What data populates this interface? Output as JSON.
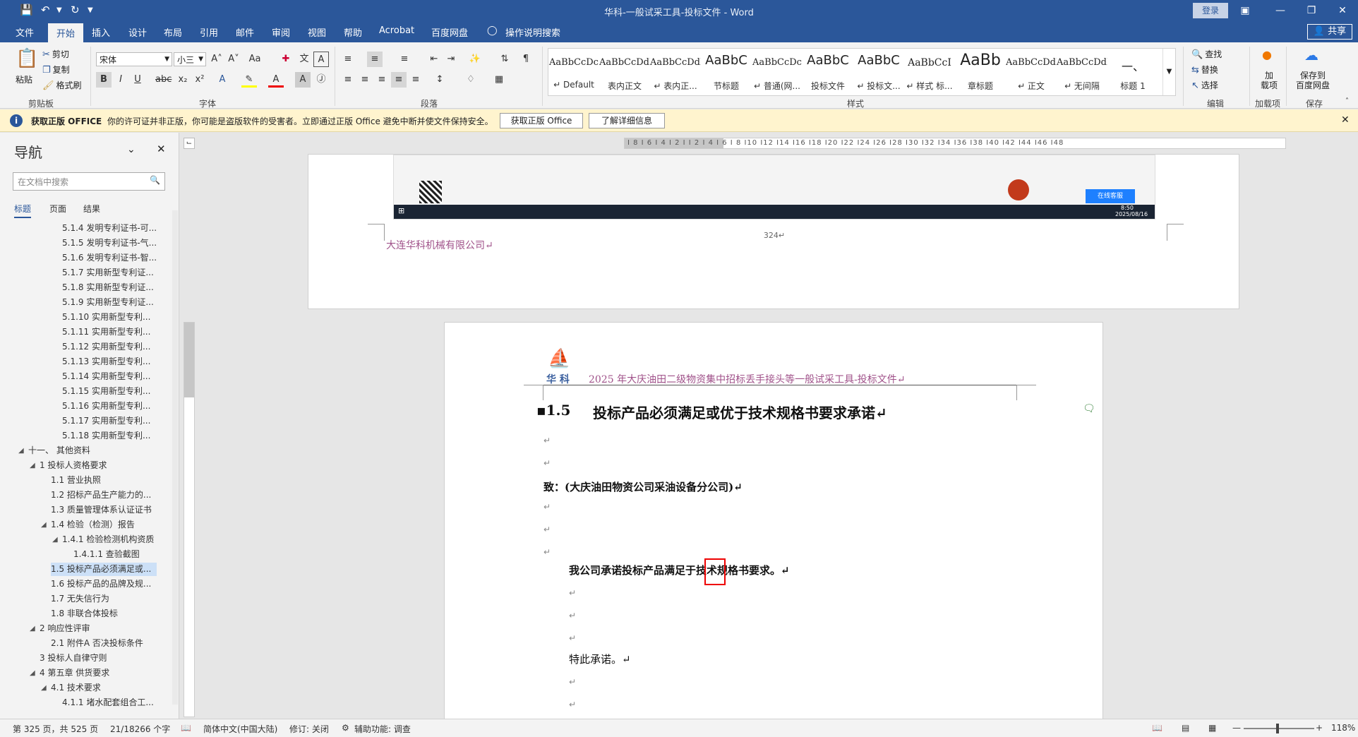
{
  "titlebar": {
    "title": "华科-一般试采工具-投标文件  -  Word",
    "login": "登录",
    "undo_icon": "undo-icon",
    "redo_icon": "redo-icon"
  },
  "menu": {
    "tabs": [
      "文件",
      "开始",
      "插入",
      "设计",
      "布局",
      "引用",
      "邮件",
      "审阅",
      "视图",
      "帮助",
      "Acrobat",
      "百度网盘"
    ],
    "tell_me": "操作说明搜索",
    "share": "共享"
  },
  "ribbon": {
    "clipboard": {
      "paste": "粘贴",
      "cut": "剪切",
      "copy": "复制",
      "format_painter": "格式刷",
      "label": "剪贴板"
    },
    "font": {
      "name": "宋体",
      "size": "小三",
      "label": "字体"
    },
    "paragraph": {
      "label": "段落"
    },
    "styles": {
      "label": "样式",
      "items": [
        {
          "sample": "AaBbCcDc",
          "name": "↵ Default"
        },
        {
          "sample": "AaBbCcDdI",
          "name": "表内正文"
        },
        {
          "sample": "AaBbCcDdI",
          "name": "↵ 表内正..."
        },
        {
          "sample": "AaBbC",
          "name": "节标题"
        },
        {
          "sample": "AaBbCcDc",
          "name": "↵ 普通(网..."
        },
        {
          "sample": "AaBbC",
          "name": "投标文件"
        },
        {
          "sample": "AaBbC",
          "name": "↵ 投标文..."
        },
        {
          "sample": "AaBbCcI",
          "name": "↵ 样式 标..."
        },
        {
          "sample": "AaBb",
          "name": "章标题"
        },
        {
          "sample": "AaBbCcDdI",
          "name": "↵ 正文"
        },
        {
          "sample": "AaBbCcDdI",
          "name": "↵ 无间隔"
        },
        {
          "sample": "一、",
          "name": "标题 1"
        }
      ]
    },
    "editing": {
      "find": "查找",
      "replace": "替换",
      "select": "选择",
      "label": "编辑"
    },
    "addins": {
      "load": "加\n载项",
      "label": "加载项"
    },
    "save": {
      "baidu": "保存到\n百度网盘",
      "label": "保存"
    }
  },
  "infobar": {
    "title": "获取正版 OFFICE",
    "message": "你的许可证并非正版，你可能是盗版软件的受害者。立即通过正版 Office 避免中断并使文件保持安全。",
    "btn_get": "获取正版 Office",
    "btn_learn": "了解详细信息"
  },
  "nav": {
    "title": "导航",
    "search_placeholder": "在文档中搜索",
    "tabs": [
      "标题",
      "页面",
      "结果"
    ],
    "items": [
      {
        "text": "5.1.4 发明专利证书-可...",
        "level": 4,
        "tri": ""
      },
      {
        "text": "5.1.5 发明专利证书-气...",
        "level": 4,
        "tri": ""
      },
      {
        "text": "5.1.6 发明专利证书-智...",
        "level": 4,
        "tri": ""
      },
      {
        "text": "5.1.7 实用新型专利证...",
        "level": 4,
        "tri": ""
      },
      {
        "text": "5.1.8 实用新型专利证...",
        "level": 4,
        "tri": ""
      },
      {
        "text": "5.1.9 实用新型专利证...",
        "level": 4,
        "tri": ""
      },
      {
        "text": "5.1.10 实用新型专利...",
        "level": 4,
        "tri": ""
      },
      {
        "text": "5.1.11 实用新型专利...",
        "level": 4,
        "tri": ""
      },
      {
        "text": "5.1.12 实用新型专利...",
        "level": 4,
        "tri": ""
      },
      {
        "text": "5.1.13 实用新型专利...",
        "level": 4,
        "tri": ""
      },
      {
        "text": "5.1.14 实用新型专利...",
        "level": 4,
        "tri": ""
      },
      {
        "text": "5.1.15 实用新型专利...",
        "level": 4,
        "tri": ""
      },
      {
        "text": "5.1.16 实用新型专利...",
        "level": 4,
        "tri": ""
      },
      {
        "text": "5.1.17 实用新型专利...",
        "level": 4,
        "tri": ""
      },
      {
        "text": "5.1.18 实用新型专利...",
        "level": 4,
        "tri": ""
      },
      {
        "text": "十一、 其他资料",
        "level": 1,
        "tri": "◢"
      },
      {
        "text": "1 投标人资格要求",
        "level": 2,
        "tri": "◢"
      },
      {
        "text": "1.1 营业执照",
        "level": 3,
        "tri": ""
      },
      {
        "text": "1.2 招标产品生产能力的...",
        "level": 3,
        "tri": ""
      },
      {
        "text": "1.3 质量管理体系认证证书",
        "level": 3,
        "tri": ""
      },
      {
        "text": "1.4 检验（检测）报告",
        "level": 3,
        "tri": "◢"
      },
      {
        "text": "1.4.1 检验检测机构资质",
        "level": 4,
        "tri": "◢"
      },
      {
        "text": "1.4.1.1 查验截图",
        "level": 5,
        "tri": ""
      },
      {
        "text": "1.5 投标产品必须满足或...",
        "level": 3,
        "tri": "",
        "selected": true
      },
      {
        "text": "1.6 投标产品的品牌及规...",
        "level": 3,
        "tri": ""
      },
      {
        "text": "1.7 无失信行为",
        "level": 3,
        "tri": ""
      },
      {
        "text": "1.8 非联合体投标",
        "level": 3,
        "tri": ""
      },
      {
        "text": "2 响应性评审",
        "level": 2,
        "tri": "◢"
      },
      {
        "text": "2.1 附件A 否决投标条件",
        "level": 3,
        "tri": ""
      },
      {
        "text": "3 投标人自律守则",
        "level": 2,
        "tri": ""
      },
      {
        "text": "4 第五章  供货要求",
        "level": 2,
        "tri": "◢"
      },
      {
        "text": "4.1 技术要求",
        "level": 3,
        "tri": "◢"
      },
      {
        "text": "4.1.1 堵水配套组合工...",
        "level": 4,
        "tri": ""
      }
    ]
  },
  "document": {
    "page1": {
      "page_number": "324↵",
      "company_footer": "大连华科机械有限公司↵",
      "taskbar_time": "8:50",
      "taskbar_date": "2025/08/16",
      "online_service": "在线客服"
    },
    "page2": {
      "logo_text": "华 科",
      "header": "2025 年大庆油田二级物资集中招标丢手接头等一般试采工具-投标文件↵",
      "heading_num": "1.5",
      "heading": "投标产品必须满足或优于技术规格书要求承诺↵",
      "to_line": "致：(大庆油田物资公司采油设备分公司)↵",
      "commit_line": "我公司承诺投标产品满足于技术规格书要求。↵",
      "closing": "特此承诺。↵",
      "para_mark": "↵"
    }
  },
  "status": {
    "page": "第 325 页，共 525 页",
    "words": "21/18266 个字",
    "language": "简体中文(中国大陆)",
    "revisions": "修订: 关闭",
    "accessibility": "辅助功能: 调查",
    "zoom": "118%"
  }
}
